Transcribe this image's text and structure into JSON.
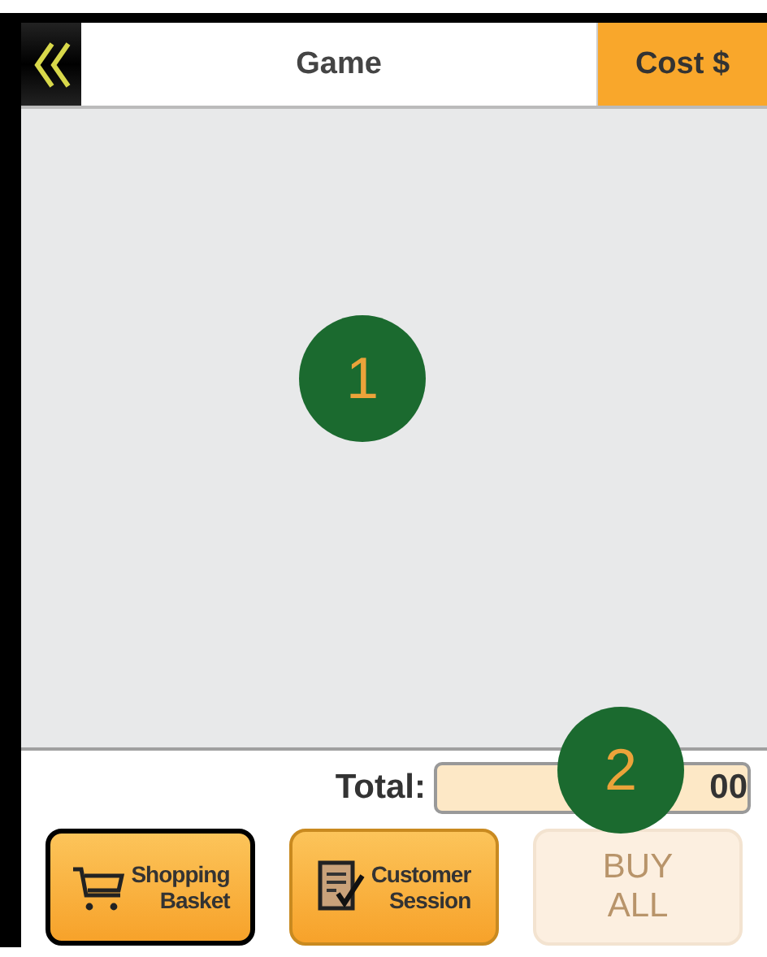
{
  "header": {
    "columns": [
      {
        "label": "Game",
        "kind": "plain"
      },
      {
        "label": "Cost $",
        "kind": "accent"
      }
    ]
  },
  "total": {
    "label": "Total:",
    "value": "00"
  },
  "buttons": [
    {
      "lines": [
        "Shopping",
        "Basket"
      ],
      "kind": "cart",
      "selected": true,
      "disabled": false
    },
    {
      "lines": [
        "Customer",
        "Session"
      ],
      "kind": "session",
      "selected": false,
      "disabled": false
    },
    {
      "lines": [
        "BUY",
        "ALL"
      ],
      "kind": "none",
      "selected": false,
      "disabled": true
    }
  ],
  "callouts": [
    {
      "label": "1",
      "kind": "list"
    },
    {
      "label": "2",
      "kind": "total"
    }
  ]
}
